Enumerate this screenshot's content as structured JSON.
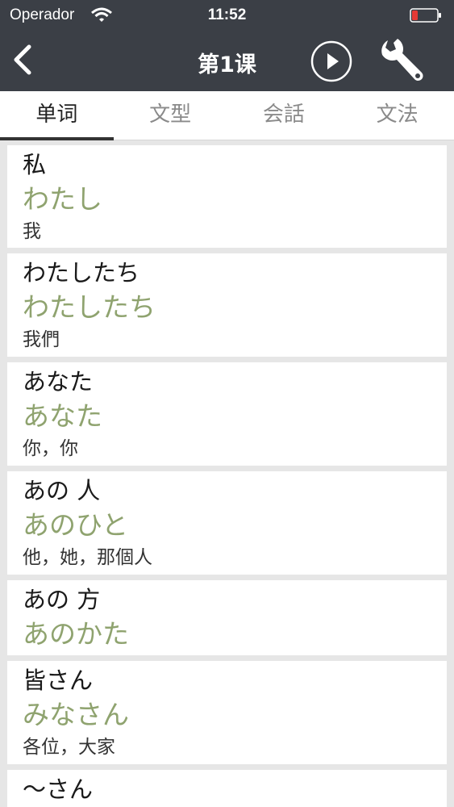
{
  "status_bar": {
    "carrier": "Operador",
    "time": "11:52"
  },
  "nav": {
    "title": "第1课",
    "icons": {
      "back": "chevron-left-icon",
      "play": "play-circle-icon",
      "settings": "wrench-icon"
    }
  },
  "tabs": [
    {
      "label": "单词",
      "active": true
    },
    {
      "label": "文型",
      "active": false
    },
    {
      "label": "会話",
      "active": false
    },
    {
      "label": "文法",
      "active": false
    }
  ],
  "vocab": [
    {
      "word": "私",
      "reading": "わたし",
      "meaning": "我"
    },
    {
      "word": "わたしたち",
      "reading": "わたしたち",
      "meaning": "我們"
    },
    {
      "word": "あなた",
      "reading": "あなた",
      "meaning": "你，你"
    },
    {
      "word": "あの 人",
      "reading": "あのひと",
      "meaning": "他，她，那個人"
    },
    {
      "word": "あの 方",
      "reading": "あのかた",
      "meaning": ""
    },
    {
      "word": "皆さん",
      "reading": "みなさん",
      "meaning": "各位，大家"
    },
    {
      "word": "～さん",
      "reading": "",
      "meaning": ""
    }
  ],
  "colors": {
    "header_bg": "#3b3f46",
    "reading": "#8fa36f",
    "battery_low": "#e53935"
  }
}
